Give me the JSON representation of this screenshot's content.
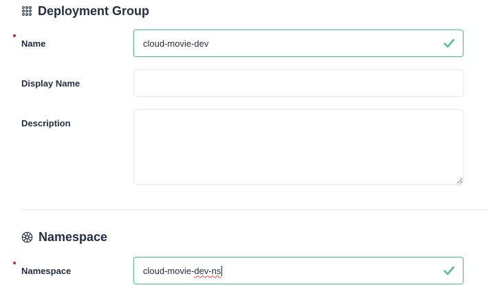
{
  "deployment_group": {
    "title": "Deployment Group",
    "icon": "grid-dots-icon",
    "name_label": "Name",
    "name_value": "cloud-movie-dev",
    "display_name_label": "Display Name",
    "display_name_value": "",
    "description_label": "Description",
    "description_value": ""
  },
  "namespace": {
    "title": "Namespace",
    "icon": "namespace-icon",
    "namespace_label": "Namespace",
    "namespace_value_prefix": "cloud-movie-",
    "namespace_value_misspelled": "dev-ns"
  },
  "colors": {
    "valid_border": "#55bc8a",
    "check_mark": "#55bc8a",
    "required_dot": "#ca2621",
    "field_border": "#e3e9ef",
    "text": "#242e42"
  }
}
